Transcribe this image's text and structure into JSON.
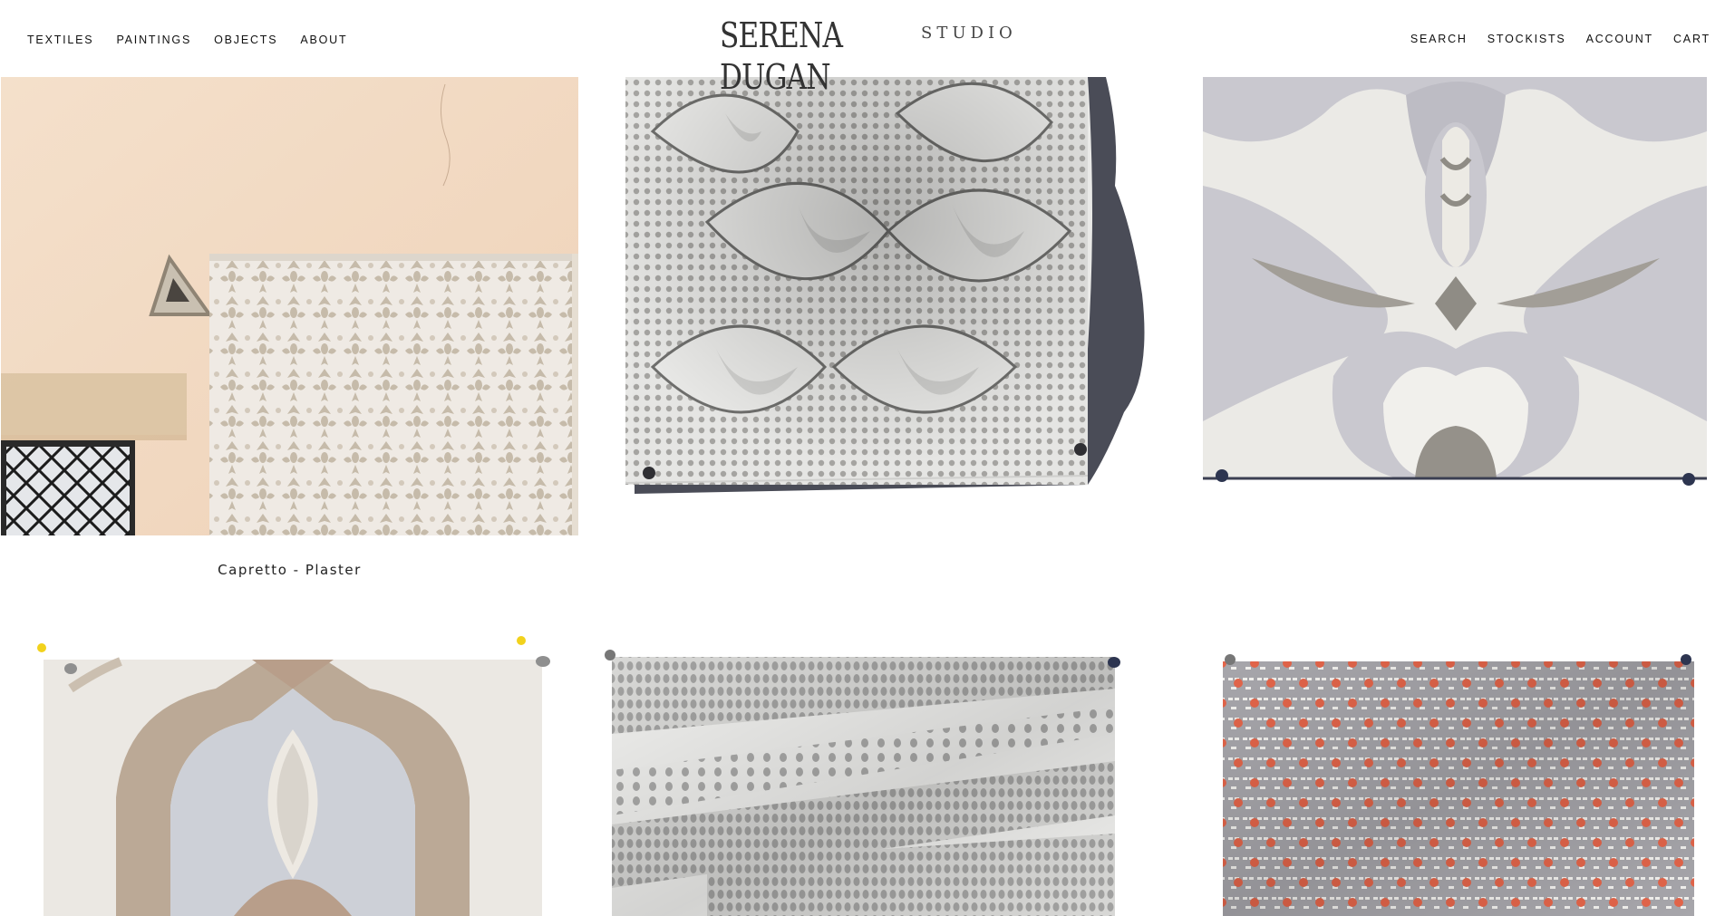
{
  "header": {
    "logo": {
      "main": "SERENA DUGAN",
      "sub": "STUDIO"
    },
    "nav_left": [
      {
        "label": "TEXTILES"
      },
      {
        "label": "PAINTINGS"
      },
      {
        "label": "OBJECTS"
      },
      {
        "label": "ABOUT"
      }
    ],
    "nav_right": [
      {
        "label": "SEARCH"
      },
      {
        "label": "STOCKISTS"
      },
      {
        "label": "ACCOUNT"
      },
      {
        "label": "CART"
      }
    ]
  },
  "products": [
    {
      "caption": "Capretto - Plaster",
      "pattern": "capretto-plaster"
    },
    {
      "caption": "",
      "pattern": "grey-leaf-lattice"
    },
    {
      "caption": "",
      "pattern": "grey-flower-medallion"
    },
    {
      "caption": "",
      "pattern": "taupe-arch"
    },
    {
      "caption": "",
      "pattern": "grey-dot-stripes"
    },
    {
      "caption": "",
      "pattern": "grey-orange-dots"
    }
  ],
  "colors": {
    "plaster_wall": "#f3dcc6",
    "linen": "#e8e6e0",
    "taupe": "#b8ab98",
    "grey": "#a8a8ab",
    "lavender_grey": "#c9c8cf",
    "orange_dot": "#e2674a"
  }
}
